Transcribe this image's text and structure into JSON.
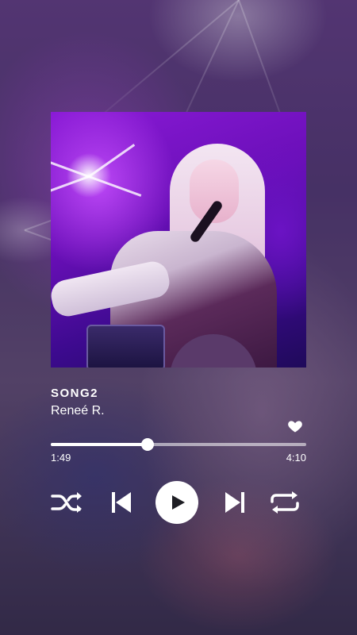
{
  "track": {
    "title": "SONG2",
    "artist": "Reneé R.",
    "liked": true
  },
  "progress": {
    "current": "1:49",
    "total": "4:10",
    "fraction": 0.38
  },
  "controls": {
    "shuffle": "shuffle-icon",
    "previous": "skip-previous-icon",
    "play": "play-icon",
    "next": "skip-next-icon",
    "repeat": "repeat-icon"
  },
  "colors": {
    "accent": "#ffffff",
    "play_icon": "#1e1e24"
  }
}
